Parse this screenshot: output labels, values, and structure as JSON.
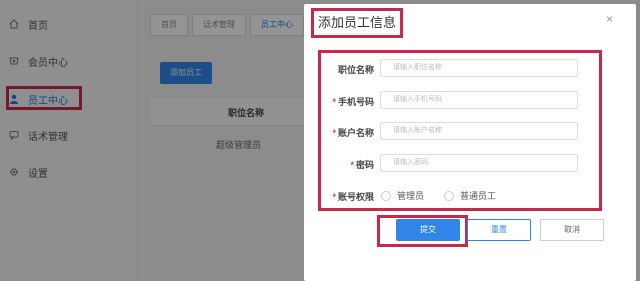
{
  "sidebar": {
    "items": [
      {
        "label": "首页",
        "icon": "home-icon"
      },
      {
        "label": "会员中心",
        "icon": "member-icon"
      },
      {
        "label": "员工中心",
        "icon": "user-icon"
      },
      {
        "label": "话术管理",
        "icon": "chat-icon"
      },
      {
        "label": "设置",
        "icon": "gear-icon"
      }
    ]
  },
  "main": {
    "tabs": [
      "首页",
      "话术管理",
      "员工中心"
    ],
    "add_button": "添加员工",
    "table": {
      "header": "职位名称",
      "rows": [
        "超级管理员"
      ]
    }
  },
  "dialog": {
    "title": "添加员工信息",
    "close": "×",
    "fields": [
      {
        "label": "职位名称",
        "placeholder": "请输入职位名称",
        "required": false
      },
      {
        "label": "手机号码",
        "placeholder": "请输入手机号码",
        "required": true
      },
      {
        "label": "账户名称",
        "placeholder": "请输入账户名称",
        "required": true
      },
      {
        "label": "密码",
        "placeholder": "请输入密码",
        "required": true
      }
    ],
    "permission": {
      "label": "账号权限",
      "required": true,
      "options": [
        "管理员",
        "普通员工"
      ]
    },
    "buttons": {
      "submit": "提交",
      "reset": "重置",
      "cancel": "取消"
    },
    "required_mark": "*"
  },
  "colors": {
    "highlight": "#c42b4a",
    "primary": "#2f86e8",
    "required": "#e23b3b"
  }
}
